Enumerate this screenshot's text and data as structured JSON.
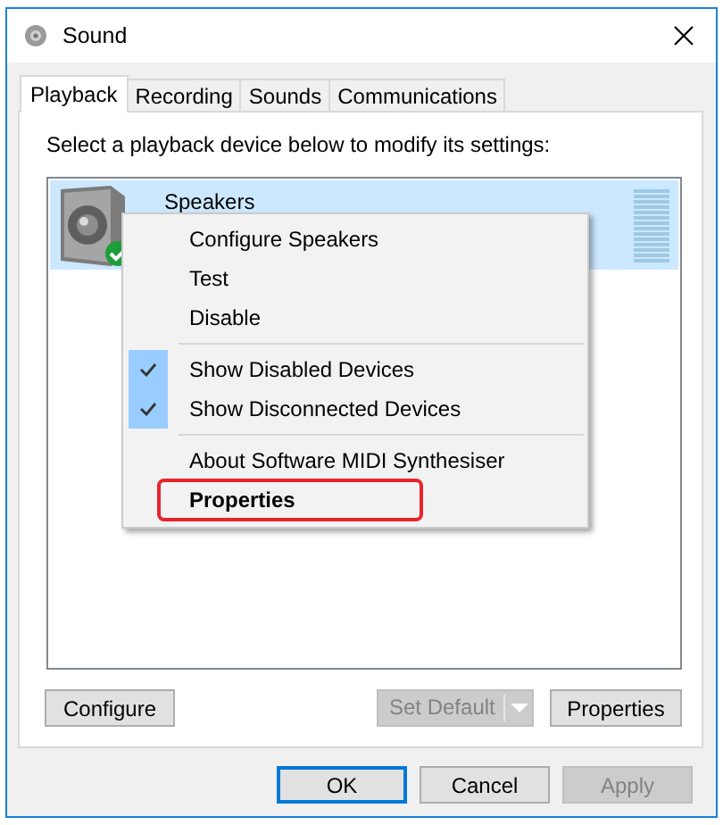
{
  "window": {
    "title": "Sound"
  },
  "tabs": [
    {
      "label": "Playback",
      "selected": true
    },
    {
      "label": "Recording",
      "selected": false
    },
    {
      "label": "Sounds",
      "selected": false
    },
    {
      "label": "Communications",
      "selected": false
    }
  ],
  "instruction": "Select a playback device below to modify its settings:",
  "devices": [
    {
      "name": "Speakers",
      "selected": true,
      "default": true
    }
  ],
  "context_menu": [
    {
      "kind": "item",
      "label": "Configure Speakers",
      "checked": false,
      "default_action": false,
      "highlighted": false
    },
    {
      "kind": "item",
      "label": "Test",
      "checked": false,
      "default_action": false,
      "highlighted": false
    },
    {
      "kind": "item",
      "label": "Disable",
      "checked": false,
      "default_action": false,
      "highlighted": false
    },
    {
      "kind": "separator"
    },
    {
      "kind": "item",
      "label": "Show Disabled Devices",
      "checked": true,
      "default_action": false,
      "highlighted": false
    },
    {
      "kind": "item",
      "label": "Show Disconnected Devices",
      "checked": true,
      "default_action": false,
      "highlighted": false
    },
    {
      "kind": "separator"
    },
    {
      "kind": "item",
      "label": "About Software MIDI Synthesiser",
      "checked": false,
      "default_action": false,
      "highlighted": false
    },
    {
      "kind": "item",
      "label": "Properties",
      "checked": false,
      "default_action": true,
      "highlighted": true
    }
  ],
  "panel_buttons": [
    {
      "label": "Configure",
      "disabled": false,
      "kind": "button"
    },
    {
      "label": "Set Default",
      "disabled": true,
      "kind": "split"
    },
    {
      "label": "Properties",
      "disabled": false,
      "kind": "button"
    }
  ],
  "dialog_buttons": [
    {
      "label": "OK",
      "disabled": false,
      "focused": true
    },
    {
      "label": "Cancel",
      "disabled": false,
      "focused": false
    },
    {
      "label": "Apply",
      "disabled": true,
      "focused": false
    }
  ]
}
